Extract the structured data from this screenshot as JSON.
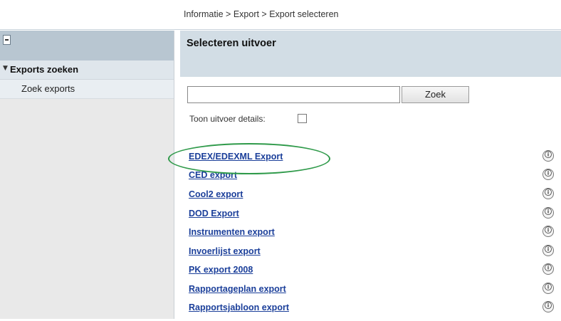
{
  "breadcrumb": "Informatie > Export > Export selecteren",
  "sidebar": {
    "collapse_icon": "minus-box-icon",
    "section_label": "Exports zoeken",
    "section_arrow": "▼",
    "items": [
      {
        "label": "Zoek exports"
      }
    ]
  },
  "main": {
    "title": "Selecteren uitvoer",
    "search": {
      "value": "",
      "button_label": "Zoek"
    },
    "details_label": "Toon uitvoer details:",
    "details_checked": false,
    "exports": [
      {
        "label": "EDEX/EDEXML Export",
        "info_icon": "info-icon"
      },
      {
        "label": "CED export",
        "info_icon": "info-icon"
      },
      {
        "label": "Cool2 export",
        "info_icon": "info-icon"
      },
      {
        "label": "DOD Export",
        "info_icon": "info-icon"
      },
      {
        "label": "Instrumenten export",
        "info_icon": "info-icon"
      },
      {
        "label": "Invoerlijst export",
        "info_icon": "info-icon"
      },
      {
        "label": "PK export 2008",
        "info_icon": "info-icon"
      },
      {
        "label": "Rapportageplan export",
        "info_icon": "info-icon"
      },
      {
        "label": "Rapportsjabloon export",
        "info_icon": "info-icon"
      }
    ],
    "info_glyph": "ⓘ"
  },
  "colors": {
    "link": "#1b3f9a",
    "header_bg": "#d2dde5",
    "sidebar_head_bg": "#b8c6d1",
    "highlight": "#2f9a4a"
  }
}
